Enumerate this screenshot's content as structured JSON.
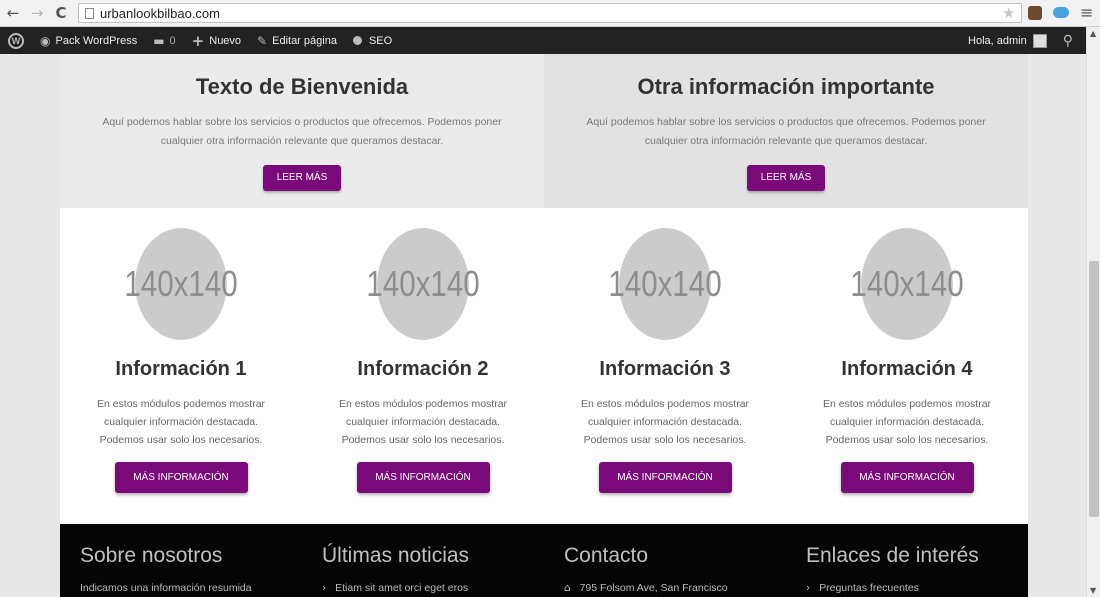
{
  "browser": {
    "url": "urbanlookbilbao.com",
    "back_icon": "arrow-left",
    "forward_icon": "arrow-right",
    "reload_icon": "reload",
    "back_glyph": "←",
    "forward_glyph": "→",
    "reload_glyph": "C",
    "star_glyph": "★",
    "menu_glyph": "≡"
  },
  "adminbar": {
    "site_name": "Pack WordPress",
    "comments_count": "0",
    "new_label": "Nuevo",
    "edit_label": "Editar página",
    "seo_label": "SEO",
    "greeting": "Hola, admin",
    "plus_glyph": "+",
    "edit_glyph": "✎",
    "comment_glyph": "▬",
    "dashboard_glyph": "◉",
    "search_glyph": "⚲"
  },
  "promos": [
    {
      "title": "Texto de Bienvenida",
      "text": "Aquí podemos hablar sobre los servicios o productos que ofrecemos. Podemos poner cualquier otra información relevante que queramos destacar.",
      "button": "LEER MÁS"
    },
    {
      "title": "Otra información importante",
      "text": "Aquí podemos hablar sobre los servicios o productos que ofrecemos. Podemos poner cualquier otra información relevante que queramos destacar.",
      "button": "LEER MÁS"
    }
  ],
  "features": [
    {
      "placeholder": "140x140",
      "title": "Información 1",
      "text": "En estos módulos podemos mostrar cualquier información destacada. Podemos usar solo los necesarios.",
      "button": "MÁS INFORMACIÓN"
    },
    {
      "placeholder": "140x140",
      "title": "Información 2",
      "text": "En estos módulos podemos mostrar cualquier información destacada. Podemos usar solo los necesarios.",
      "button": "MÁS INFORMACIÓN"
    },
    {
      "placeholder": "140x140",
      "title": "Información 3",
      "text": "En estos módulos podemos mostrar cualquier información destacada. Podemos usar solo los necesarios.",
      "button": "MÁS INFORMACIÓN"
    },
    {
      "placeholder": "140x140",
      "title": "Información 4",
      "text": "En estos módulos podemos mostrar cualquier información destacada. Podemos usar solo los necesarios.",
      "button": "MÁS INFORMACIÓN"
    }
  ],
  "footer": {
    "columns": [
      {
        "title": "Sobre nosotros",
        "line": "Indicamos una información resumida",
        "icon": ""
      },
      {
        "title": "Últimas noticias",
        "line": "Etiam sit amet orci eget eros",
        "icon": "›"
      },
      {
        "title": "Contacto",
        "line": "795 Folsom Ave, San Francisco",
        "icon": "⌂"
      },
      {
        "title": "Enlaces de interés",
        "line": "Preguntas frecuentes",
        "icon": "›"
      }
    ]
  },
  "colors": {
    "accent": "#7a0a7a",
    "admin_bar": "#222222",
    "footer_bg": "#050505"
  }
}
